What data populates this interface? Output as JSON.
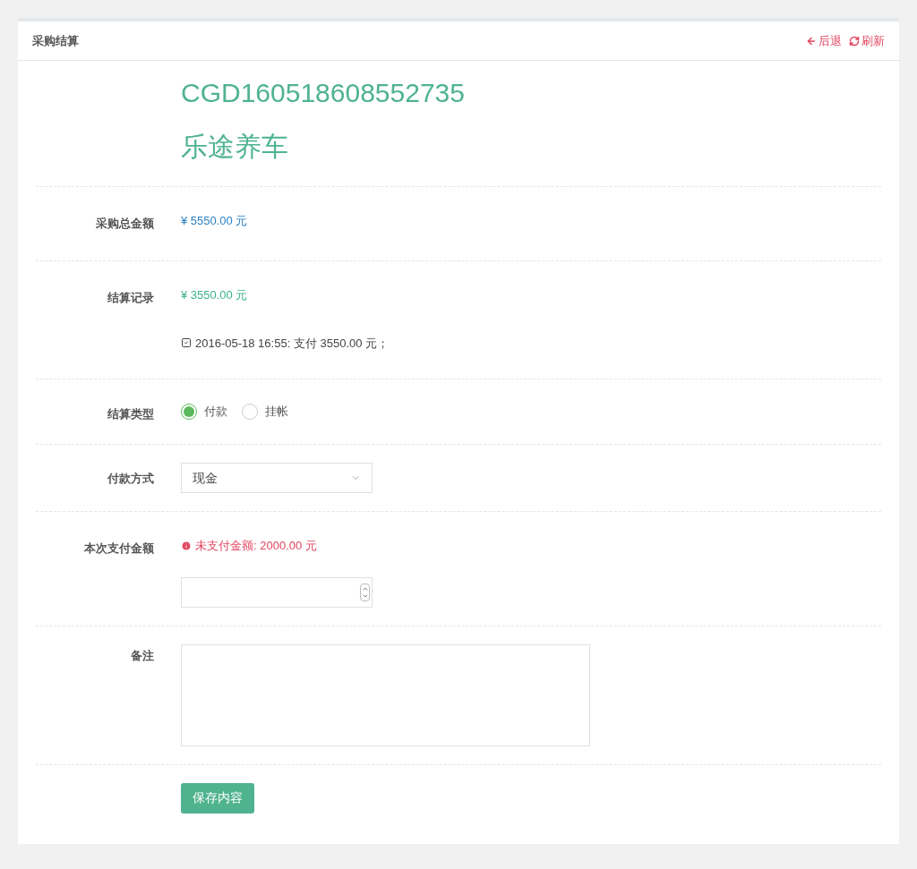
{
  "panel": {
    "title": "采购结算",
    "actions": [
      {
        "kind": "back",
        "label": "后退"
      },
      {
        "kind": "refresh",
        "label": "刷新"
      }
    ]
  },
  "order": {
    "code": "CGD160518608552735",
    "supplier": "乐途养车"
  },
  "total": {
    "label": "采购总金额",
    "value": "¥ 5550.00 元"
  },
  "records": {
    "label": "结算记录",
    "value": "¥ 3550.00 元",
    "entries": [
      "2016-05-18 16:55: 支付 3550.00 元；"
    ]
  },
  "settle_type": {
    "label": "结算类型",
    "options": [
      {
        "label": "付款",
        "selected": true
      },
      {
        "label": "挂帐",
        "selected": false
      }
    ]
  },
  "pay_method": {
    "label": "付款方式",
    "value": "现金"
  },
  "pay_amount": {
    "label": "本次支付金额",
    "notice": "未支付金额: 2000.00 元"
  },
  "note": {
    "label": "备注"
  },
  "save_button": "保存内容"
}
